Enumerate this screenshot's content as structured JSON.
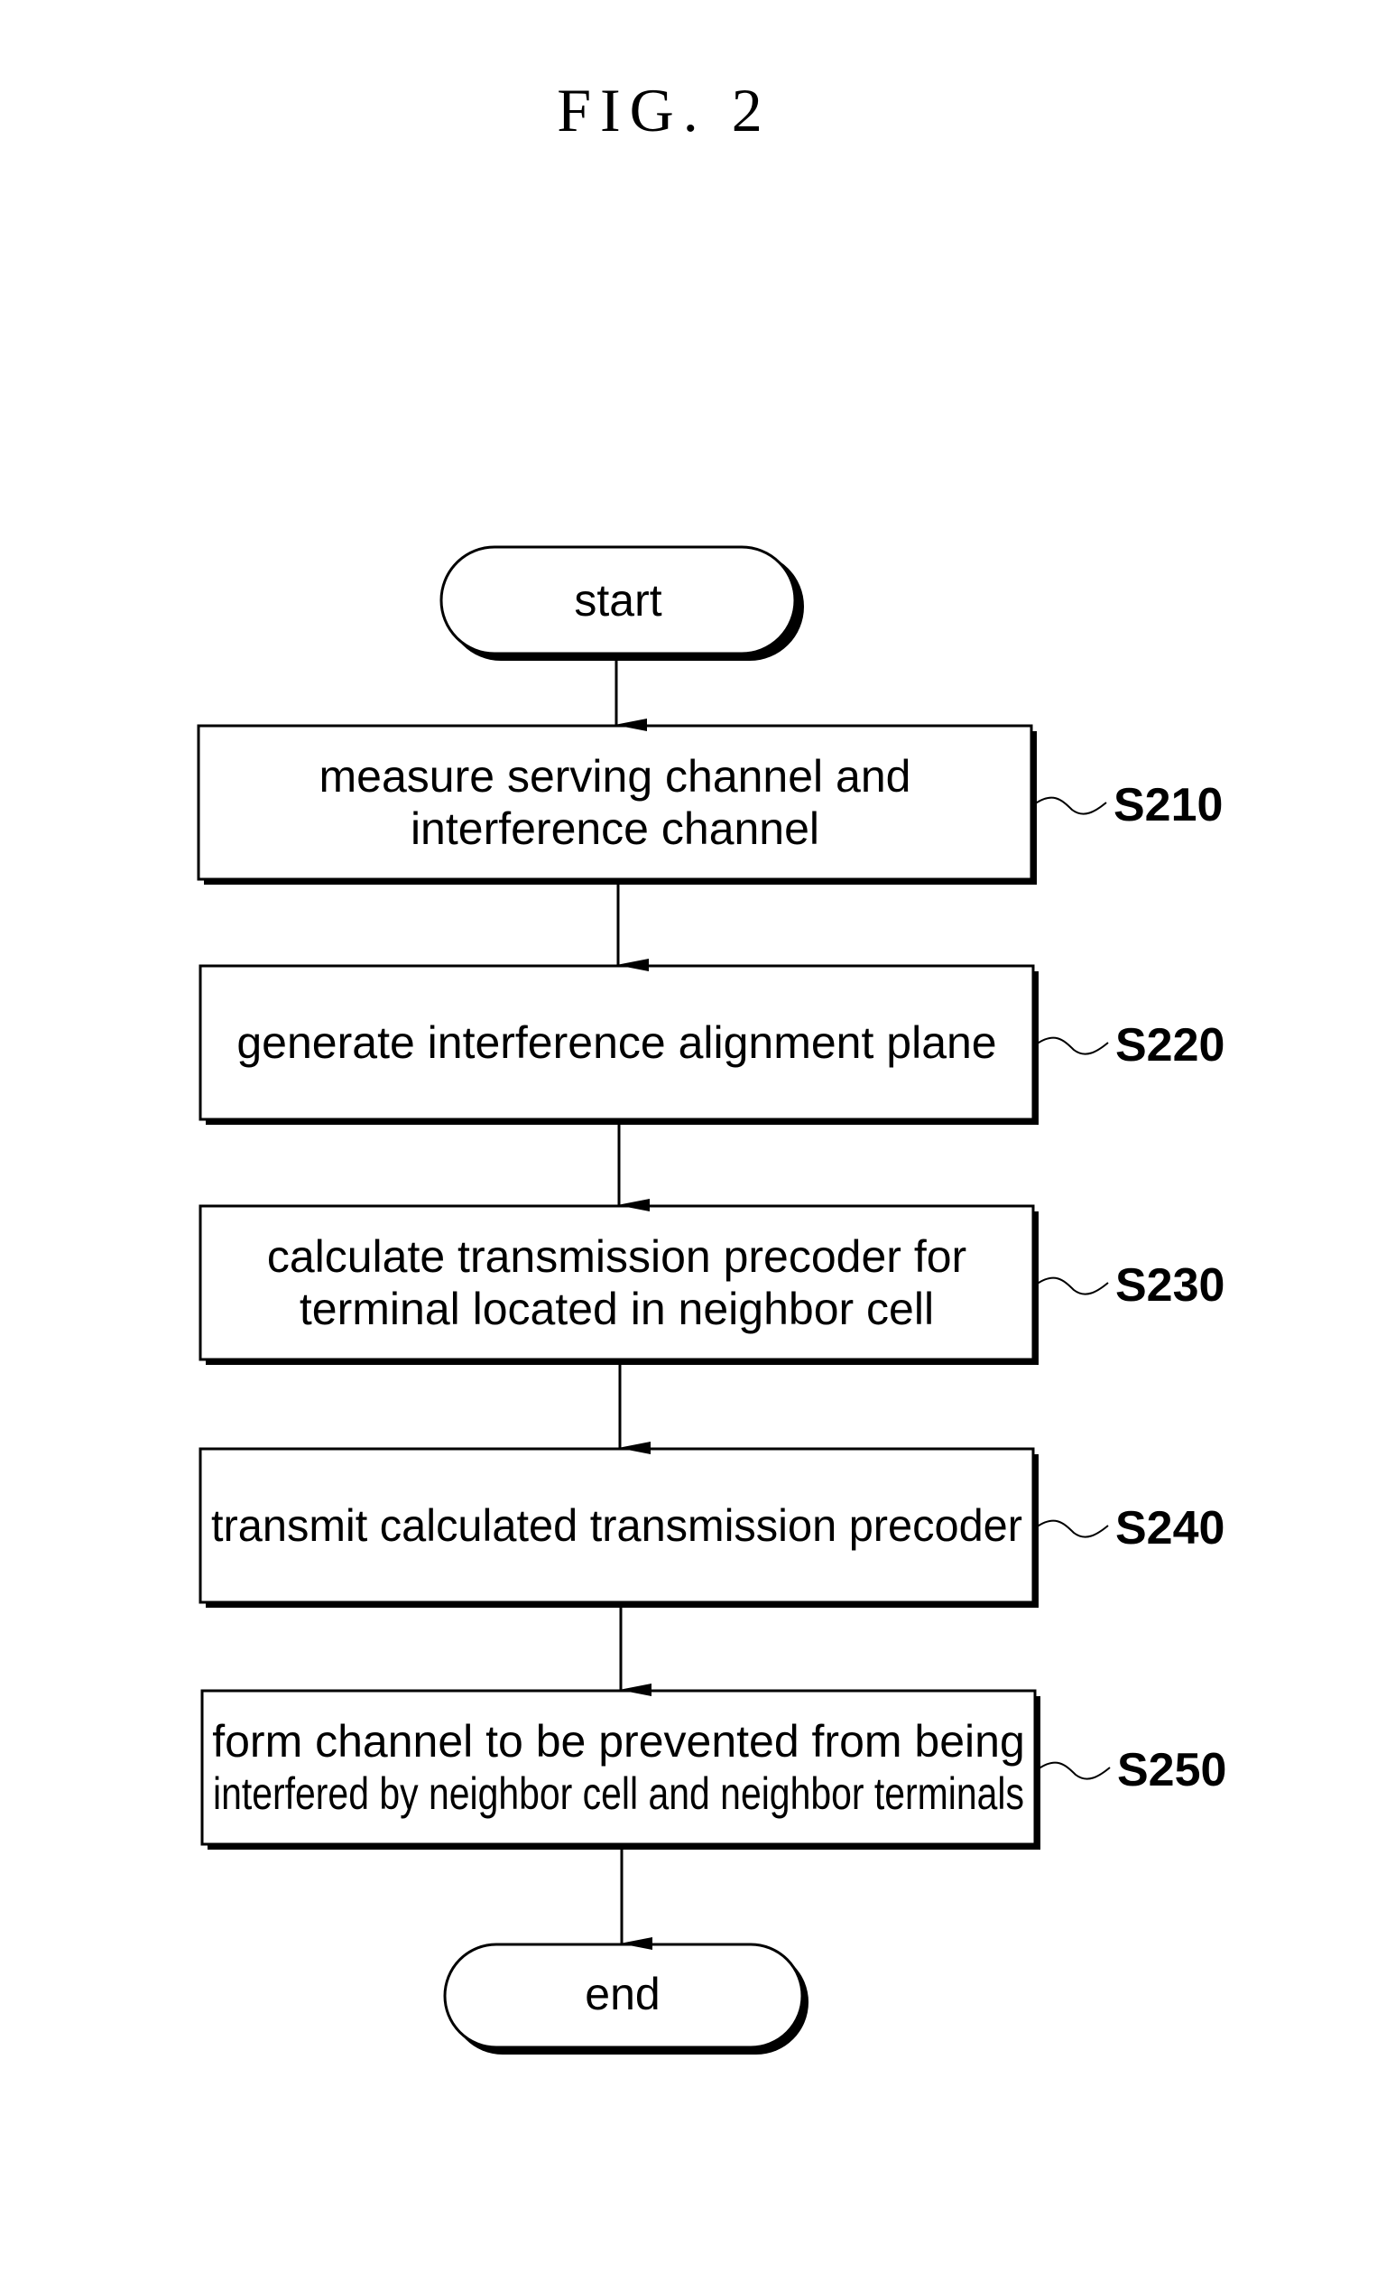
{
  "figure": {
    "title": "FIG. 2"
  },
  "flowchart": {
    "start": {
      "label": "start"
    },
    "steps": [
      {
        "id": "S210",
        "lines": [
          "measure serving channel and",
          "interference channel"
        ]
      },
      {
        "id": "S220",
        "lines": [
          "generate interference alignment plane"
        ]
      },
      {
        "id": "S230",
        "lines": [
          "calculate transmission precoder for",
          "terminal located in neighbor cell"
        ]
      },
      {
        "id": "S240",
        "lines": [
          "transmit calculated transmission precoder"
        ]
      },
      {
        "id": "S250",
        "lines": [
          "form channel to be prevented from being",
          "interfered by neighbor cell and neighbor terminals"
        ]
      }
    ],
    "end": {
      "label": "end"
    }
  }
}
